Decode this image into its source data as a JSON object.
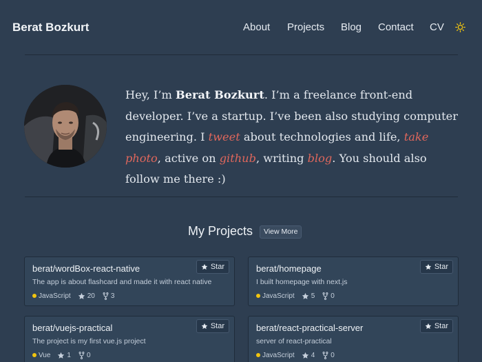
{
  "header": {
    "brand": "Berat Bozkurt",
    "nav": [
      {
        "label": "About"
      },
      {
        "label": "Projects"
      },
      {
        "label": "Blog"
      },
      {
        "label": "Contact"
      },
      {
        "label": "CV"
      }
    ],
    "theme_icon": "sun-icon"
  },
  "intro": {
    "greeting": "Hey, I’m ",
    "name": "Berat Bozkurt",
    "text1": ". I’m a freelance front-end developer. I’ve a startup. I’ve been also studying computer engineering. I ",
    "link_tweet": "tweet",
    "text2": " about technologies and life, ",
    "link_photo": "take photo",
    "text3": ", active on ",
    "link_github": "github",
    "text4": ", writing ",
    "link_blog": "blog",
    "text5": ". You should also follow me there :)"
  },
  "projects": {
    "title": "My Projects",
    "view_more": "View More",
    "star_label": "Star",
    "items": [
      {
        "name": "berat/wordBox-react-native",
        "description": "The app is about flashcard and made it with react native",
        "language": "JavaScript",
        "stars": "20",
        "forks": "3"
      },
      {
        "name": "berat/homepage",
        "description": "I built homepage with next.js",
        "language": "JavaScript",
        "stars": "5",
        "forks": "0"
      },
      {
        "name": "berat/vuejs-practical",
        "description": "The project is my first vue.js project",
        "language": "Vue",
        "stars": "1",
        "forks": "0"
      },
      {
        "name": "berat/react-practical-server",
        "description": "server of react-practical",
        "language": "JavaScript",
        "stars": "4",
        "forks": "0"
      }
    ]
  },
  "colors": {
    "background": "#2e3e51",
    "link": "#e0675c",
    "language_dot": "#f1c40f",
    "sun": "#f1c40f"
  }
}
